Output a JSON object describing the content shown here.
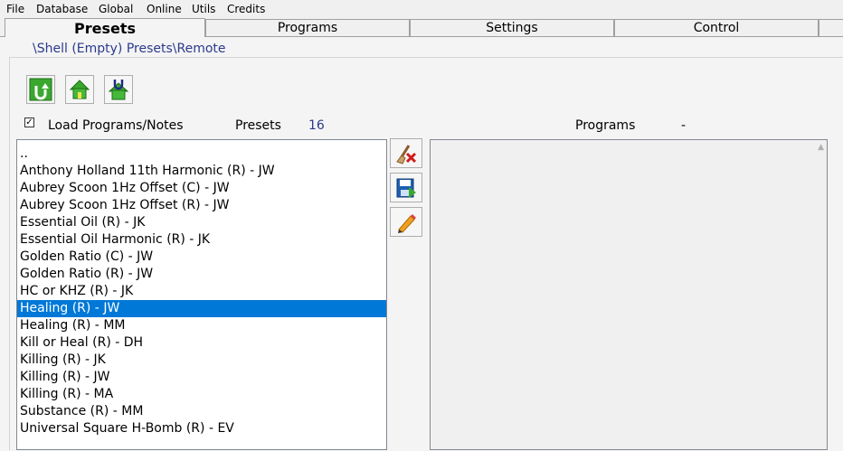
{
  "menu": [
    "File",
    "Database",
    "Global",
    "Online",
    "Utils",
    "Credits"
  ],
  "tabs": [
    "Presets",
    "Programs",
    "Settings",
    "Control"
  ],
  "active_tab": "Presets",
  "path": "\\Shell (Empty) Presets\\Remote",
  "nav_buttons": [
    "up-arrow-icon",
    "home-icon",
    "magnet-home-icon"
  ],
  "load_checkbox": {
    "checked": true,
    "label": "Load Programs/Notes",
    "mark": "✓"
  },
  "presets_label": "Presets",
  "presets_count": "16",
  "programs_label": "Programs",
  "programs_value": "-",
  "presets_list": [
    "..",
    "Anthony Holland 11th Harmonic (R) - JW",
    "Aubrey Scoon 1Hz Offset (C) - JW",
    "Aubrey Scoon 1Hz Offset (R) - JW",
    "Essential Oil (R) - JK",
    "Essential Oil Harmonic (R) - JK",
    "Golden Ratio (C) - JW",
    "Golden Ratio (R) - JW",
    "HC or KHZ (R) - JK",
    "Healing (R) - JW",
    "Healing (R) - MM",
    "Kill or Heal (R) - DH",
    "Killing (R) - JK",
    "Killing (R) - JW",
    "Killing (R) - MA",
    "Substance (R) - MM",
    "Universal Square H-Bomb (R) - EV"
  ],
  "selected_preset": "Healing (R) - JW",
  "side_tools": [
    "delete-icon",
    "save-icon",
    "edit-pencil-icon"
  ],
  "colors": {
    "selection": "#0078d7",
    "path_text": "#2b3a8c",
    "icon_green": "#3aa82e"
  }
}
